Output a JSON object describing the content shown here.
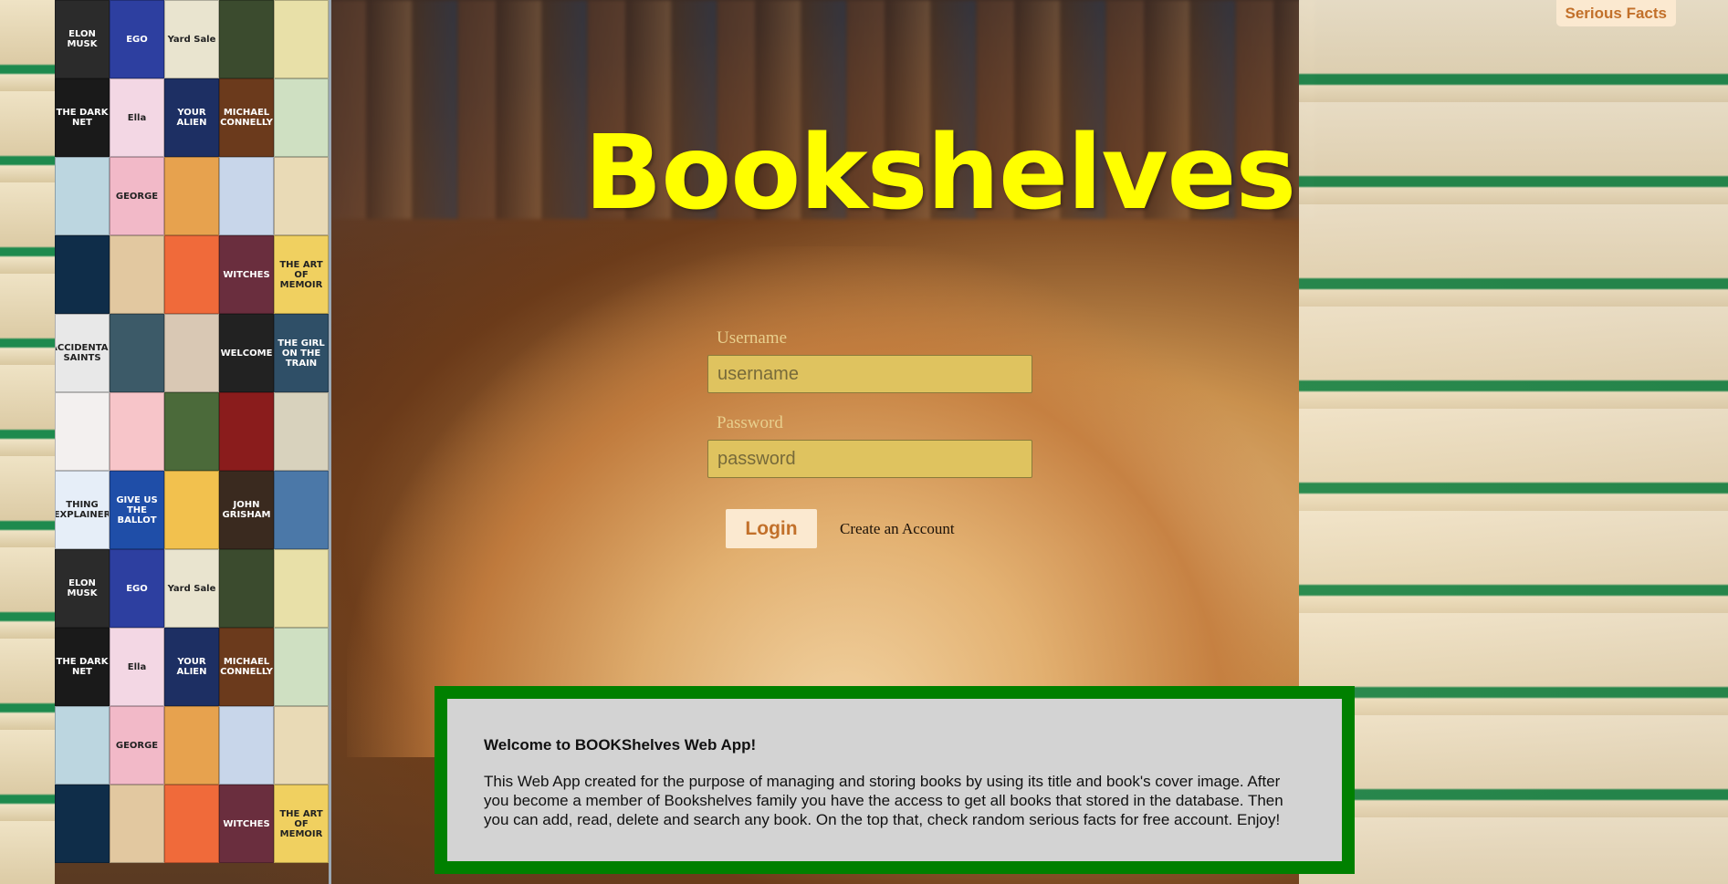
{
  "header": {
    "serious_facts_label": "Serious Facts"
  },
  "app_title": "Bookshelves",
  "login_form": {
    "username_label": "Username",
    "username_placeholder": "username",
    "password_label": "Password",
    "password_placeholder": "password",
    "login_button": "Login",
    "create_account_link": "Create an Account"
  },
  "welcome": {
    "heading": "Welcome to BOOKShelves Web App!",
    "body": "This Web App created for the purpose of managing and storing books by using its title and book's cover image. After you become a member of Bookshelves family you have the access to get all books that stored in the database. Then you can add, read, delete and search any book. On the top that, check random serious facts for free account. Enjoy!"
  },
  "mosaic_tiles": [
    {
      "text": "ELON MUSK",
      "color": "#2b2b2b"
    },
    {
      "text": "EGO",
      "color": "#2d3fa0"
    },
    {
      "text": "Yard Sale",
      "color": "#e9e4cf"
    },
    {
      "text": "",
      "color": "#3b4b2e"
    },
    {
      "text": "",
      "color": "#e8e0a8"
    },
    {
      "text": "THE DARK NET",
      "color": "#1a1a1a"
    },
    {
      "text": "Ella",
      "color": "#f3d7e4"
    },
    {
      "text": "YOUR ALIEN",
      "color": "#1d2f63"
    },
    {
      "text": "MICHAEL CONNELLY",
      "color": "#6b3a1c"
    },
    {
      "text": "",
      "color": "#cfe0c2"
    },
    {
      "text": "",
      "color": "#bcd6e0"
    },
    {
      "text": "GEORGE",
      "color": "#f2b9c8"
    },
    {
      "text": "",
      "color": "#e7a24e"
    },
    {
      "text": "",
      "color": "#c8d6ea"
    },
    {
      "text": "",
      "color": "#e9dab6"
    },
    {
      "text": "",
      "color": "#0f2d49"
    },
    {
      "text": "",
      "color": "#e2c8a0"
    },
    {
      "text": "",
      "color": "#f06a3a"
    },
    {
      "text": "WITCHES",
      "color": "#6a2e3e"
    },
    {
      "text": "THE ART OF MEMOIR",
      "color": "#f0d060"
    },
    {
      "text": "ACCIDENTAL SAINTS",
      "color": "#e8e8e8"
    },
    {
      "text": "",
      "color": "#3c5a68"
    },
    {
      "text": "",
      "color": "#d9c8b4"
    },
    {
      "text": "WELCOME",
      "color": "#222222"
    },
    {
      "text": "THE GIRL ON THE TRAIN",
      "color": "#2f4f67"
    },
    {
      "text": "",
      "color": "#f3f0ef"
    },
    {
      "text": "",
      "color": "#f7c5c9"
    },
    {
      "text": "",
      "color": "#4b6a3a"
    },
    {
      "text": "",
      "color": "#8a1c1c"
    },
    {
      "text": "",
      "color": "#d8d2bd"
    },
    {
      "text": "THING EXPLAINER",
      "color": "#e6eef8"
    },
    {
      "text": "GIVE US THE BALLOT",
      "color": "#1f4ea8"
    },
    {
      "text": "",
      "color": "#f2c14e"
    },
    {
      "text": "JOHN GRISHAM",
      "color": "#3a2a1f"
    },
    {
      "text": "",
      "color": "#4b78a8"
    },
    {
      "text": "ELON MUSK",
      "color": "#2b2b2b"
    },
    {
      "text": "EGO",
      "color": "#2d3fa0"
    },
    {
      "text": "Yard Sale",
      "color": "#e9e4cf"
    },
    {
      "text": "",
      "color": "#3b4b2e"
    },
    {
      "text": "",
      "color": "#e8e0a8"
    },
    {
      "text": "THE DARK NET",
      "color": "#1a1a1a"
    },
    {
      "text": "Ella",
      "color": "#f3d7e4"
    },
    {
      "text": "YOUR ALIEN",
      "color": "#1d2f63"
    },
    {
      "text": "MICHAEL CONNELLY",
      "color": "#6b3a1c"
    },
    {
      "text": "",
      "color": "#cfe0c2"
    },
    {
      "text": "",
      "color": "#bcd6e0"
    },
    {
      "text": "GEORGE",
      "color": "#f2b9c8"
    },
    {
      "text": "",
      "color": "#e7a24e"
    },
    {
      "text": "",
      "color": "#c8d6ea"
    },
    {
      "text": "",
      "color": "#e9dab6"
    },
    {
      "text": "",
      "color": "#0f2d49"
    },
    {
      "text": "",
      "color": "#e2c8a0"
    },
    {
      "text": "",
      "color": "#f06a3a"
    },
    {
      "text": "WITCHES",
      "color": "#6a2e3e"
    },
    {
      "text": "THE ART OF MEMOIR",
      "color": "#f0d060"
    }
  ]
}
